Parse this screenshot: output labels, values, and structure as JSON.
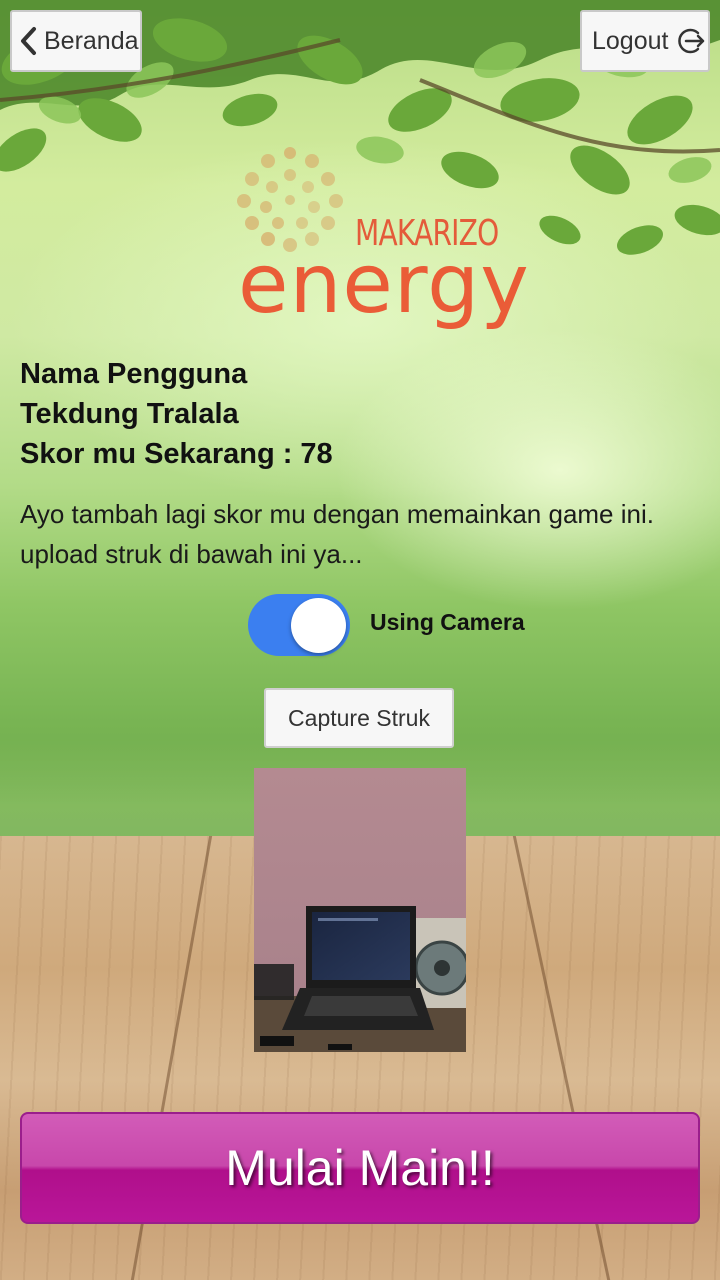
{
  "header": {
    "back_label": "Beranda",
    "logout_label": "Logout"
  },
  "logo": {
    "brand_top": "MAKARIZO",
    "brand_bottom": "energy"
  },
  "user": {
    "name_label": "Nama Pengguna",
    "name_value": "Tekdung Tralala",
    "score_text": "Skor mu Sekarang : 78"
  },
  "description": {
    "line1": "Ayo tambah lagi skor mu dengan memainkan game ini.",
    "line2": "upload struk di bawah ini ya..."
  },
  "camera_toggle": {
    "label": "Using Camera",
    "on": true,
    "color": "#3b7ff0"
  },
  "capture": {
    "button_label": "Capture Struk"
  },
  "play": {
    "button_label": "Mulai Main!!",
    "color": "#c02ca0"
  },
  "icons": {
    "back": "chevron-left-icon",
    "logout": "logout-icon"
  }
}
